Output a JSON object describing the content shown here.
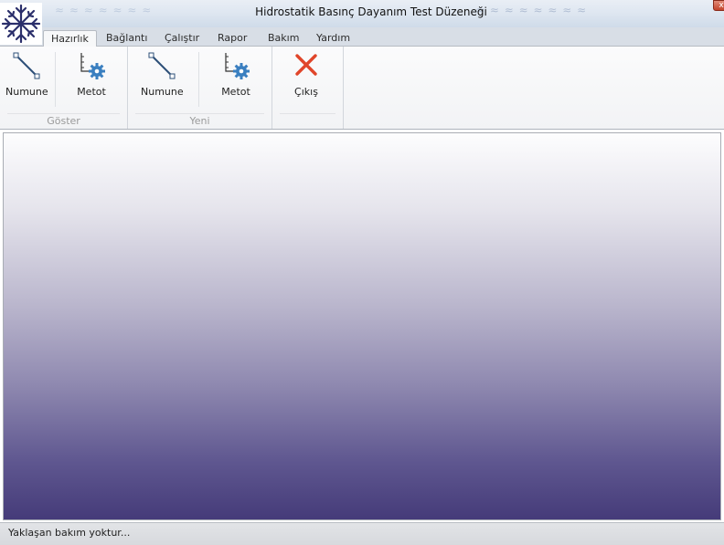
{
  "window": {
    "title": "Hidrostatik Basınç Dayanım Test Düzeneği",
    "close_glyph": "x"
  },
  "app_button": {
    "icon": "snowflake-icon",
    "color": "#2b2f6b"
  },
  "tabs": [
    {
      "label": "Hazırlık",
      "active": true
    },
    {
      "label": "Bağlantı",
      "active": false
    },
    {
      "label": "Çalıştır",
      "active": false
    },
    {
      "label": "Rapor",
      "active": false
    },
    {
      "label": "Bakım",
      "active": false
    },
    {
      "label": "Yardım",
      "active": false
    }
  ],
  "ribbon": {
    "groups": [
      {
        "label": "Göster",
        "buttons": [
          {
            "label": "Numune",
            "icon": "line-segment-icon"
          },
          {
            "label": "Metot",
            "icon": "axis-gear-icon"
          }
        ]
      },
      {
        "label": "Yeni",
        "buttons": [
          {
            "label": "Numune",
            "icon": "line-segment-icon"
          },
          {
            "label": "Metot",
            "icon": "axis-gear-icon"
          }
        ]
      },
      {
        "label": "",
        "buttons": [
          {
            "label": "Çıkış",
            "icon": "red-x-icon"
          }
        ]
      }
    ]
  },
  "status": {
    "text": "Yaklaşan bakım yoktur..."
  },
  "colors": {
    "accent_gear": "#3a7fc0",
    "exit_red": "#e0452a",
    "workspace_bottom": "#453b79"
  }
}
